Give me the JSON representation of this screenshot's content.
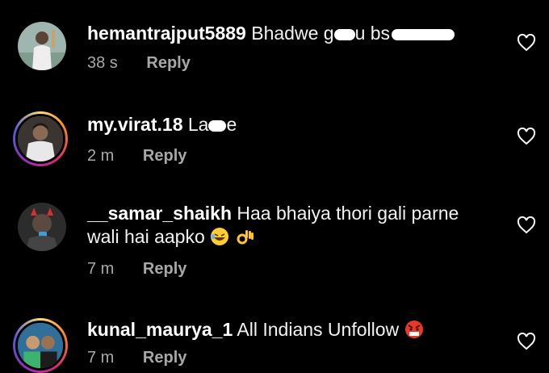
{
  "comments": [
    {
      "username": "hemantrajput5889",
      "text": "Bhadwe g",
      "text_after": "u bs",
      "time": "38 s",
      "reply_label": "Reply"
    },
    {
      "username": "my.virat.18",
      "text": "La",
      "text_after": "e",
      "time": "2 m",
      "reply_label": "Reply"
    },
    {
      "username": "__samar_shaikh",
      "text": "Haa bhaiya thori gali parne",
      "text_line2": "wali hai aapko",
      "time": "7 m",
      "reply_label": "Reply"
    },
    {
      "username": "kunal_maurya_1",
      "text": "All Indians Unfollow",
      "time": "7 m",
      "reply_label": "Reply"
    }
  ],
  "icons": {
    "like": "heart-outline-icon",
    "emoji_laugh": "rolling-laughing-emoji",
    "emoji_ok": "ok-hand-emoji",
    "emoji_angry": "angry-face-emoji"
  },
  "colors": {
    "background": "#000000",
    "text": "#f5f5f5",
    "secondary": "#a8a8a8"
  }
}
